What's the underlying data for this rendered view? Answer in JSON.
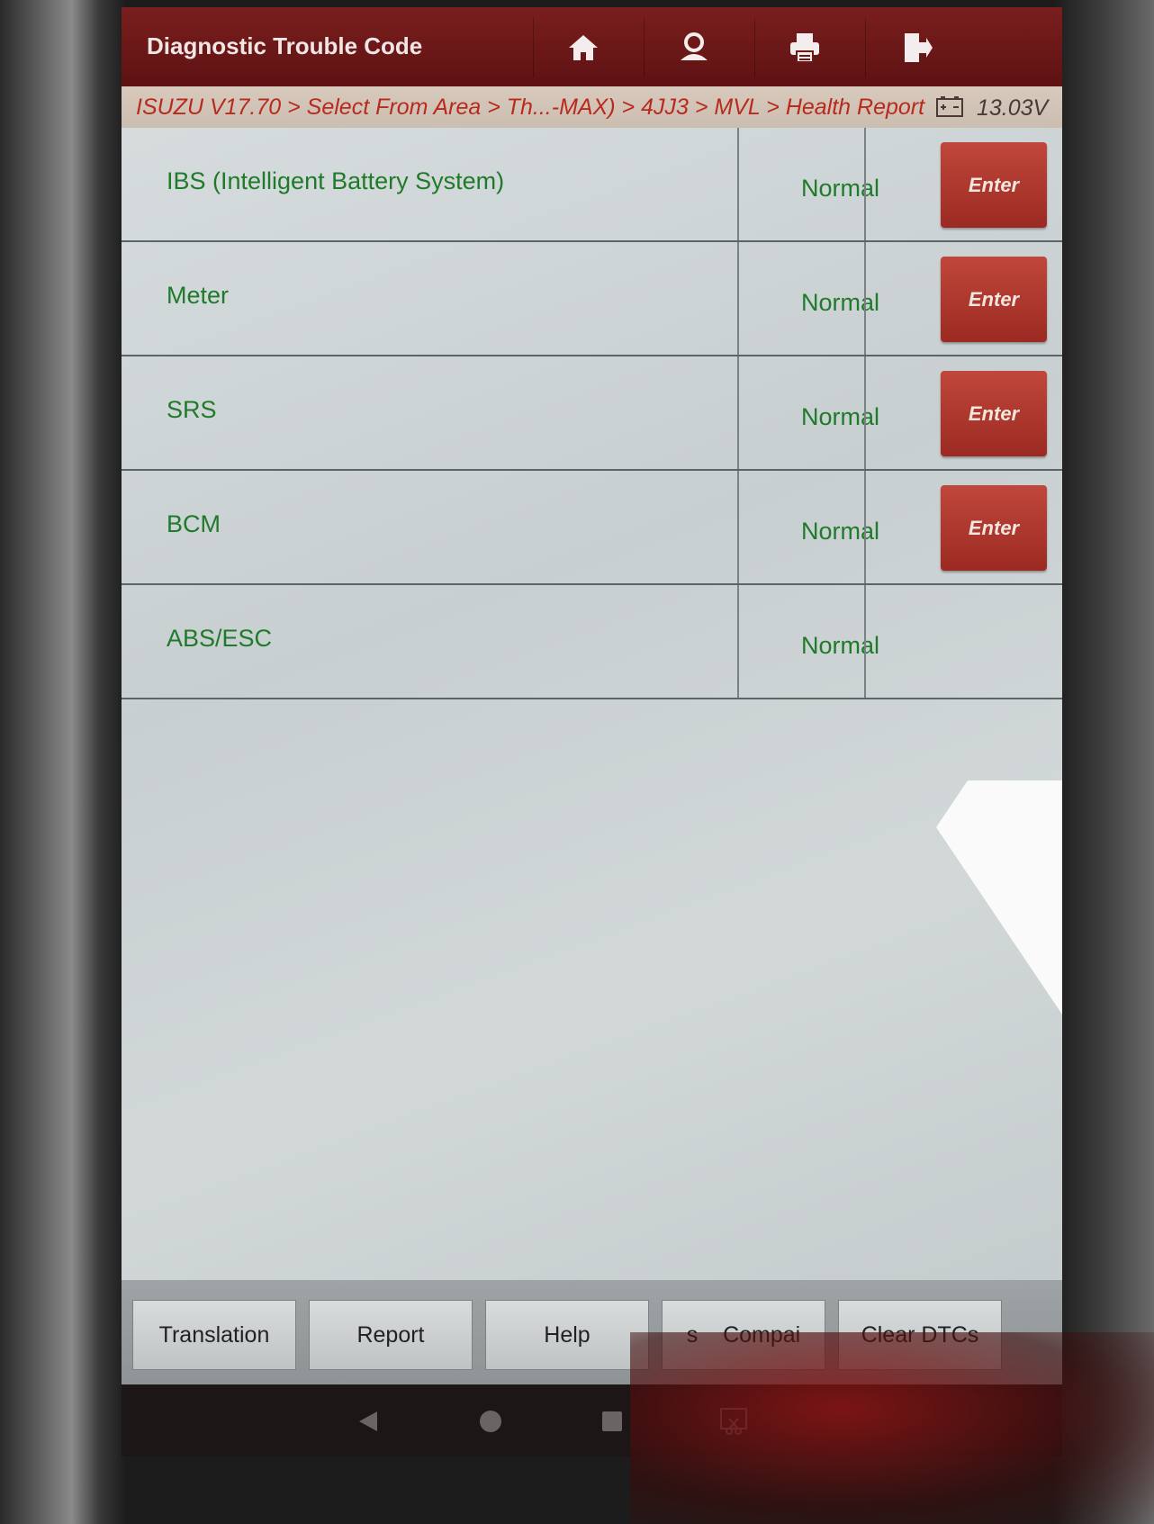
{
  "header": {
    "title": "Diagnostic Trouble Code",
    "icons": [
      "home-icon",
      "user-icon",
      "print-icon",
      "exit-icon"
    ]
  },
  "breadcrumb": {
    "path": "ISUZU V17.70 > Select From Area > Th...-MAX) > 4JJ3 > MVL > Health Report",
    "voltage": "13.03V"
  },
  "systems": [
    {
      "name": "IBS (Intelligent Battery System)",
      "status": "Normal",
      "action": "Enter"
    },
    {
      "name": "Meter",
      "status": "Normal",
      "action": "Enter"
    },
    {
      "name": "SRS",
      "status": "Normal",
      "action": "Enter"
    },
    {
      "name": "BCM",
      "status": "Normal",
      "action": "Enter"
    },
    {
      "name": "ABS/ESC",
      "status": "Normal",
      "action": ""
    }
  ],
  "footer": {
    "translation": "Translation",
    "report": "Report",
    "help": "Help",
    "compare": "s    Compai",
    "clear_dtcs": "Clear DTCs"
  },
  "colors": {
    "title_bar": "#6e1818",
    "breadcrumb_text": "#b82a1c",
    "status_text": "#1f7a2a",
    "enter_button": "#b13a30"
  }
}
